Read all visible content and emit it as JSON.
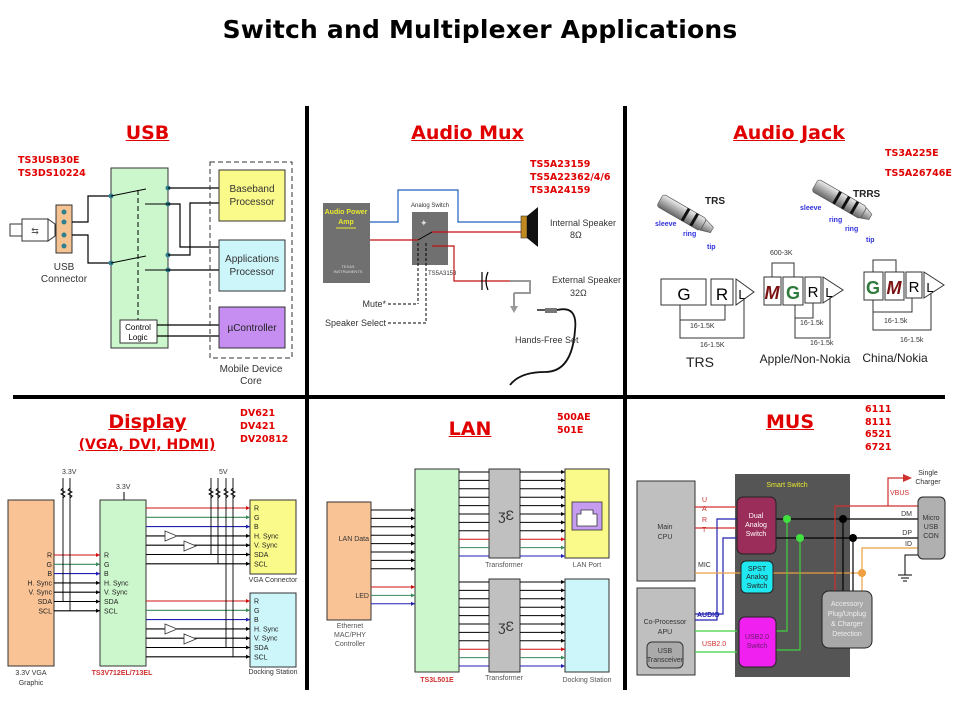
{
  "title": "Switch and Multiplexer Applications",
  "colors": {
    "section_title": "#e00000",
    "divider": "#000000",
    "signal_red": "#d01010",
    "signal_green": "#3a8a5a",
    "signal_blue": "#2020b0"
  },
  "sections": {
    "usb": {
      "title": "USB",
      "parts": [
        "TS3USB30E",
        "TS3DS10224"
      ],
      "connector_label": [
        "USB",
        "Connector"
      ],
      "control_logic": [
        "Control",
        "Logic"
      ],
      "baseband": [
        "Baseband",
        "Processor"
      ],
      "applications": [
        "Applications",
        "Processor"
      ],
      "ucontroller": "µController",
      "core_label": [
        "Mobile Device",
        "Core"
      ]
    },
    "audio_mux": {
      "title": "Audio Mux",
      "parts": [
        "TS5A23159",
        "TS5A22362/4/6",
        "TS3A24159"
      ],
      "amp_label": [
        "Audio Power",
        "Amp"
      ],
      "ti_logo": [
        "TEXAS",
        "INSTRUMENTS"
      ],
      "switch_label": "Analog Switch",
      "switch_part": "TS5A3153",
      "internal_speaker": [
        "Internal Speaker",
        "8Ω"
      ],
      "external_speaker": [
        "External Speaker",
        "32Ω"
      ],
      "mute": "Mute*",
      "speaker_select": "Speaker Select",
      "hands_free": "Hands-Free Set"
    },
    "audio_jack": {
      "title": "Audio Jack",
      "parts": [
        "TS3A225E",
        "TS5A26746E"
      ],
      "trs_plug": {
        "name": "TRS",
        "labels": [
          "sleeve",
          "ring",
          "tip"
        ]
      },
      "trrs_plug": {
        "name": "TRRS",
        "labels": [
          "sleeve",
          "ring",
          "ring",
          "tip"
        ]
      },
      "diagrams": [
        {
          "name": "TRS",
          "contacts": [
            "G",
            "R",
            "L"
          ],
          "resistors": [
            "16-1.5K",
            "16-1.5K"
          ]
        },
        {
          "name": "Apple/Non-Nokia",
          "contacts": [
            "M",
            "G",
            "R",
            "L"
          ],
          "resistors": [
            "600-3K",
            "16-1.5k",
            "16-1.5k"
          ]
        },
        {
          "name": "China/Nokia",
          "contacts": [
            "G",
            "M",
            "R",
            "L"
          ],
          "resistors": [
            "16-1.5k",
            "16-1.5k"
          ]
        }
      ]
    },
    "display": {
      "title": "Display",
      "subtitle": "(VGA, DVI, HDMI)",
      "parts": [
        "DV621",
        "DV421",
        "DV20812"
      ],
      "source_label": [
        "3.3V VGA",
        "Graphic"
      ],
      "switch_part": "TS3V712EL/713EL",
      "vga_label": "VGA Connector",
      "dock_label": "Docking Station",
      "supply_33": "3.3V",
      "supply_5": "5V",
      "signals": [
        "R",
        "G",
        "B",
        "H. Sync",
        "V. Sync",
        "SDA",
        "SCL"
      ]
    },
    "lan": {
      "title": "LAN",
      "parts": [
        "500AE",
        "501E"
      ],
      "controller_label": [
        "Ethernet",
        "MAC/PHY",
        "Controller"
      ],
      "lan_data": "LAN Data",
      "led": "LED",
      "switch_part": "TS3L501E",
      "transformer": "Transformer",
      "lan_port": "LAN Port",
      "dock_label": "Docking Station"
    },
    "mus": {
      "title": "MUS",
      "parts": [
        "6111",
        "8111",
        "6521",
        "6721"
      ],
      "main_cpu": [
        "Main",
        "CPU"
      ],
      "coprocessor": [
        "Co-Processor",
        "APU"
      ],
      "usb_transceiver": [
        "USB",
        "Transceiver"
      ],
      "smart_switch": "Smart Switch",
      "dual_switch": [
        "Dual",
        "Analog",
        "Switch"
      ],
      "spst_switch": [
        "SPST",
        "Analog",
        "Switch"
      ],
      "usb_switch": [
        "USB2.0",
        "Switch"
      ],
      "accessory": [
        "Accessory",
        "Plug/Unplug",
        "& Charger",
        "Detection"
      ],
      "micro_usb": [
        "Micro",
        "USB",
        "CON"
      ],
      "single_charger": [
        "Single",
        "Charger"
      ],
      "uart": [
        "U",
        "A",
        "R",
        "T"
      ],
      "mic": "MIC",
      "audio": "AUDIO",
      "usb20": "USB2.0",
      "vbus": "VBUS",
      "dm": "DM",
      "dp": "DP",
      "id": "ID"
    }
  }
}
